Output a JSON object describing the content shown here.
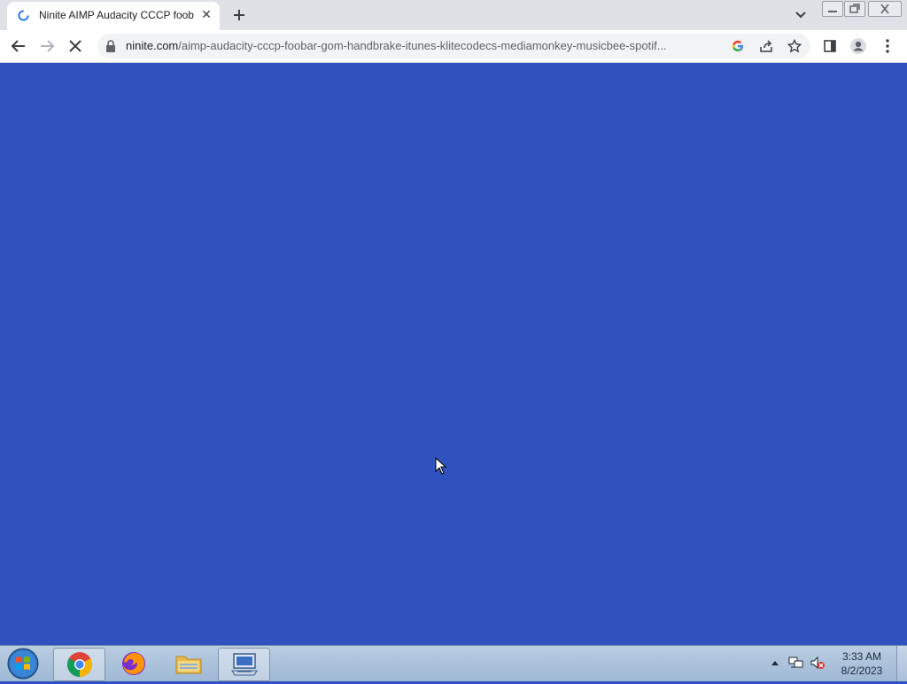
{
  "browser": {
    "tab": {
      "title": "Ninite AIMP Audacity CCCP foob",
      "icon": "loading-spinner-icon",
      "close_icon": "close-icon"
    },
    "new_tab_icon": "plus-icon",
    "tab_search_icon": "chevron-down-icon",
    "window_controls": {
      "minimize": "minimize-icon",
      "restore": "restore-icon",
      "close": "close-icon"
    },
    "toolbar": {
      "back_icon": "back-arrow-icon",
      "forward_icon": "forward-arrow-icon",
      "stop_icon": "stop-icon",
      "url_host": "ninite.com",
      "url_path": "/aimp-audacity-cccp-foobar-gom-handbrake-itunes-klitecodecs-mediamonkey-musicbee-spotif...",
      "lock_icon": "lock-icon",
      "google_icon": "google-icon",
      "share_icon": "share-icon",
      "bookmark_icon": "star-icon",
      "sidepanel_icon": "side-panel-icon",
      "profile_icon": "profile-icon",
      "menu_icon": "more-vert-icon"
    }
  },
  "page": {
    "background_color": "#3052bf"
  },
  "taskbar": {
    "start_icon": "windows-start-icon",
    "apps": [
      {
        "name": "chrome",
        "icon": "chrome-icon",
        "active": true
      },
      {
        "name": "firefox",
        "icon": "firefox-icon",
        "active": false
      },
      {
        "name": "explorer",
        "icon": "folder-icon",
        "active": false
      },
      {
        "name": "remote",
        "icon": "computer-icon",
        "active": false
      }
    ],
    "tray": {
      "arrow_icon": "caret-up-icon",
      "network_icon": "network-icon",
      "volume_icon": "volume-muted-icon"
    },
    "clock": {
      "time": "3:33 AM",
      "date": "8/2/2023"
    }
  }
}
